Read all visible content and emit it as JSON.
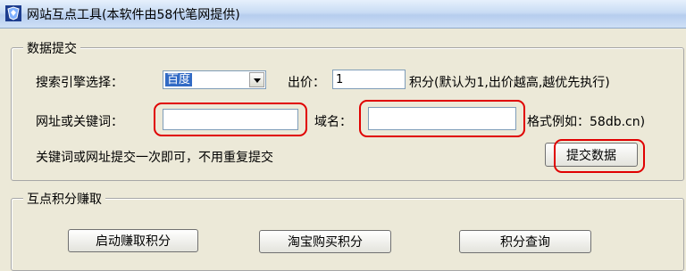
{
  "window": {
    "title": "网站互点工具(本软件由58代笔网提供)"
  },
  "submit_group": {
    "legend": "数据提交",
    "engine_label": "搜索引擎选择：",
    "engine_value": "百度",
    "bid_label": "出价：",
    "bid_value": "1",
    "bid_hint": "积分(默认为1,出价越高,越优先执行)",
    "url_label": "网址或关键词：",
    "url_value": "",
    "domain_label": "域名：",
    "domain_value": "",
    "format_hint": "格式例如：58db.cn)",
    "note": "关键词或网址提交一次即可，不用重复提交",
    "submit_button": "提交数据"
  },
  "earn_group": {
    "legend": "互点积分赚取",
    "start_button": "启动赚取积分",
    "buy_button": "淘宝购买积分",
    "query_button": "积分查询"
  },
  "colors": {
    "highlight": "#e00000",
    "selection": "#316ac5"
  }
}
